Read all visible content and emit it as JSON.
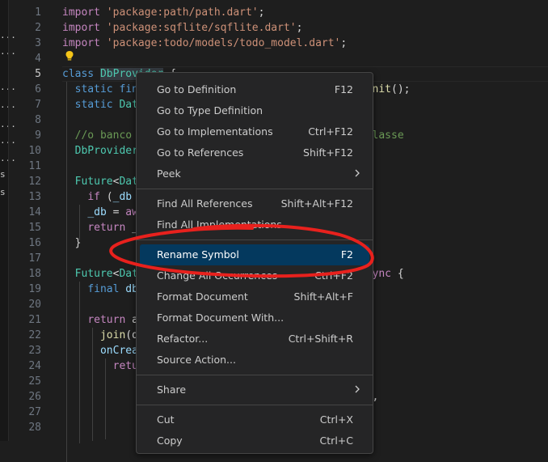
{
  "editor": {
    "current_line": 5,
    "lines": [
      {
        "n": 1,
        "tokens": [
          {
            "c": "kc",
            "t": "import"
          },
          {
            "c": "p",
            "t": " "
          },
          {
            "c": "s",
            "t": "'package:path/path.dart'"
          },
          {
            "c": "p",
            "t": ";"
          }
        ]
      },
      {
        "n": 2,
        "tokens": [
          {
            "c": "kc",
            "t": "import"
          },
          {
            "c": "p",
            "t": " "
          },
          {
            "c": "s",
            "t": "'package:sqflite/sqflite.dart'"
          },
          {
            "c": "p",
            "t": ";"
          }
        ]
      },
      {
        "n": 3,
        "tokens": [
          {
            "c": "kc",
            "t": "import"
          },
          {
            "c": "p",
            "t": " "
          },
          {
            "c": "s",
            "t": "'package:todo/models/todo_model.dart'"
          },
          {
            "c": "p",
            "t": ";"
          }
        ]
      },
      {
        "n": 4,
        "tokens": []
      },
      {
        "n": 5,
        "tokens": [
          {
            "c": "k",
            "t": "class"
          },
          {
            "c": "p",
            "t": " "
          },
          {
            "c": "t wordhl",
            "t": "DbProvider"
          },
          {
            "c": "p",
            "t": " {"
          }
        ]
      },
      {
        "n": 6,
        "tokens": [
          {
            "c": "p",
            "t": "  "
          },
          {
            "c": "k",
            "t": "static"
          },
          {
            "c": "p",
            "t": " "
          },
          {
            "c": "k",
            "t": "fin"
          },
          {
            "c": "p",
            "t": "                                   "
          },
          {
            "c": "f",
            "t": "_init"
          },
          {
            "c": "p",
            "t": "();"
          }
        ]
      },
      {
        "n": 7,
        "tokens": [
          {
            "c": "p",
            "t": "  "
          },
          {
            "c": "k",
            "t": "static"
          },
          {
            "c": "p",
            "t": " "
          },
          {
            "c": "t",
            "t": "Dat"
          }
        ]
      },
      {
        "n": 8,
        "tokens": []
      },
      {
        "n": 9,
        "tokens": [
          {
            "c": "p",
            "t": "  "
          },
          {
            "c": "c",
            "t": "//o banco"
          },
          {
            "c": "p",
            "t": "                                   "
          },
          {
            "c": "c",
            "t": "a classe"
          }
        ]
      },
      {
        "n": 10,
        "tokens": [
          {
            "c": "p",
            "t": "  "
          },
          {
            "c": "t",
            "t": "DbProvider"
          }
        ]
      },
      {
        "n": 11,
        "tokens": []
      },
      {
        "n": 12,
        "tokens": [
          {
            "c": "p",
            "t": "  "
          },
          {
            "c": "t",
            "t": "Future"
          },
          {
            "c": "p",
            "t": "<"
          },
          {
            "c": "t",
            "t": "Dat"
          }
        ]
      },
      {
        "n": 13,
        "tokens": [
          {
            "c": "p",
            "t": "    "
          },
          {
            "c": "kc",
            "t": "if"
          },
          {
            "c": "p",
            "t": " ("
          },
          {
            "c": "v",
            "t": "_db"
          }
        ]
      },
      {
        "n": 14,
        "tokens": [
          {
            "c": "p",
            "t": "    "
          },
          {
            "c": "v",
            "t": "_db"
          },
          {
            "c": "p",
            "t": " = "
          },
          {
            "c": "kc",
            "t": "aw"
          }
        ]
      },
      {
        "n": 15,
        "tokens": [
          {
            "c": "p",
            "t": "    "
          },
          {
            "c": "kc",
            "t": "return"
          },
          {
            "c": "p",
            "t": " _"
          }
        ]
      },
      {
        "n": 16,
        "tokens": [
          {
            "c": "p",
            "t": "  }"
          }
        ]
      },
      {
        "n": 17,
        "tokens": []
      },
      {
        "n": 18,
        "tokens": [
          {
            "c": "p",
            "t": "  "
          },
          {
            "c": "t",
            "t": "Future"
          },
          {
            "c": "p",
            "t": "<"
          },
          {
            "c": "t",
            "t": "Dat"
          },
          {
            "c": "p",
            "t": "                                   "
          },
          {
            "c": "kc",
            "t": "async"
          },
          {
            "c": "p",
            "t": " {"
          }
        ]
      },
      {
        "n": 19,
        "tokens": [
          {
            "c": "p",
            "t": "    "
          },
          {
            "c": "k",
            "t": "final"
          },
          {
            "c": "p",
            "t": " "
          },
          {
            "c": "v",
            "t": "db"
          }
        ]
      },
      {
        "n": 20,
        "tokens": []
      },
      {
        "n": 21,
        "tokens": [
          {
            "c": "p",
            "t": "    "
          },
          {
            "c": "kc",
            "t": "return"
          },
          {
            "c": "p",
            "t": " a"
          }
        ]
      },
      {
        "n": 22,
        "tokens": [
          {
            "c": "p",
            "t": "      "
          },
          {
            "c": "f",
            "t": "join"
          },
          {
            "c": "p",
            "t": "(d"
          }
        ]
      },
      {
        "n": 23,
        "tokens": [
          {
            "c": "p",
            "t": "      "
          },
          {
            "c": "v",
            "t": "onCrea"
          }
        ]
      },
      {
        "n": 24,
        "tokens": [
          {
            "c": "p",
            "t": "        "
          },
          {
            "c": "kc",
            "t": "retu"
          }
        ]
      },
      {
        "n": 25,
        "tokens": []
      },
      {
        "n": 26,
        "tokens": [
          {
            "c": "p",
            "t": "                                                 ,"
          }
        ]
      },
      {
        "n": 27,
        "tokens": []
      },
      {
        "n": 28,
        "tokens": []
      }
    ]
  },
  "left_strip": {
    "dots": [
      "...",
      "...",
      "...",
      "...",
      "...",
      "...",
      "...",
      "s",
      "s"
    ]
  },
  "context_menu": {
    "items": [
      {
        "label": "Go to Definition",
        "shortcut": "F12"
      },
      {
        "label": "Go to Type Definition",
        "shortcut": ""
      },
      {
        "label": "Go to Implementations",
        "shortcut": "Ctrl+F12"
      },
      {
        "label": "Go to References",
        "shortcut": "Shift+F12"
      },
      {
        "label": "Peek",
        "shortcut": "",
        "submenu": true
      },
      {
        "separator": true
      },
      {
        "label": "Find All References",
        "shortcut": "Shift+Alt+F12"
      },
      {
        "label": "Find All Implementations",
        "shortcut": ""
      },
      {
        "separator": true
      },
      {
        "label": "Rename Symbol",
        "shortcut": "F2",
        "selected": true
      },
      {
        "label": "Change All Occurrences",
        "shortcut": "Ctrl+F2"
      },
      {
        "label": "Format Document",
        "shortcut": "Shift+Alt+F"
      },
      {
        "label": "Format Document With...",
        "shortcut": ""
      },
      {
        "label": "Refactor...",
        "shortcut": "Ctrl+Shift+R"
      },
      {
        "label": "Source Action...",
        "shortcut": ""
      },
      {
        "separator": true
      },
      {
        "label": "Share",
        "shortcut": "",
        "submenu": true
      },
      {
        "separator": true
      },
      {
        "label": "Cut",
        "shortcut": "Ctrl+X"
      },
      {
        "label": "Copy",
        "shortcut": "Ctrl+C"
      }
    ]
  },
  "colors": {
    "selection": "#04395e",
    "annotation": "#e8211d",
    "bulb": "#f5c518"
  },
  "icons": {
    "lightbulb": "lightbulb-icon",
    "submenu": "chevron-right-icon"
  }
}
